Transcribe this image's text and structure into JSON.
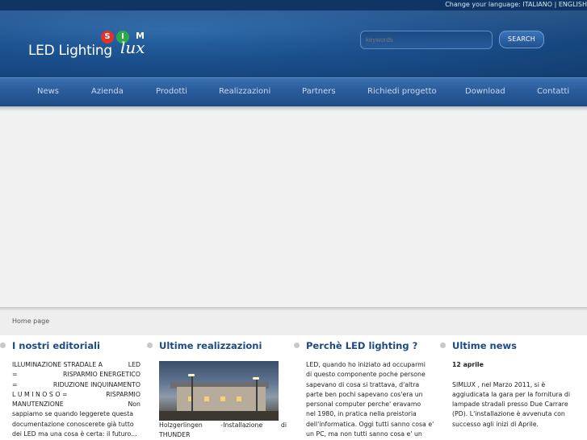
{
  "header": {
    "language_bar": "Change your language: ITALIANO | ENGLISH",
    "logo": {
      "text_main": "LED Lighting",
      "sim_letters": [
        "S",
        "I",
        "M"
      ],
      "lux": "lux",
      "colors": {
        "s": "#e2332b",
        "i": "#2fa84a"
      }
    },
    "search": {
      "placeholder": "keywords",
      "button_label": "SEARCH"
    }
  },
  "nav": {
    "items": [
      "News",
      "Azienda",
      "Prodotti",
      "Realizzazioni",
      "Partners",
      "Richiedi progetto",
      "Download",
      "Contatti"
    ]
  },
  "breadcrumb": "Home page",
  "columns": {
    "editoriali": {
      "title": "I nostri editoriali",
      "lines": [
        "ILLUMINAZIONE STRADALE A LED",
        "= RISPARMIO ENERGETICO",
        "= RIDUZIONE INQUINAMENTO",
        "L U M I N O S O = RISPARMIO",
        "MANUTENZIONE Non",
        "sappiamo se quando leggerete questa",
        "documentazione conoscerete già tutto",
        "dei LED ma una cosa è certa: il futuro..."
      ]
    },
    "realizzazioni": {
      "title": "Ultime realizzazioni",
      "caption_line1_left": "Holzgerlingen",
      "caption_line1_mid": "-Installazione",
      "caption_line1_right": "di",
      "caption_line2": "THUNDER"
    },
    "perche": {
      "title": "Perchè LED lighting ?",
      "lines": [
        "LED, quando ho iniziato ad occuparmi",
        "di questo componente poche persone",
        "sapevano di cosa si trattava, d'altra",
        "parte ben pochi sapevano cos'era un",
        "personal computer perche' eravamo",
        "nel 1980, in pratica nella preistoria",
        "dell'informatica. Oggi tutti sanno cosa e'",
        "un PC, ma non tutti sanno cosa e' un"
      ]
    },
    "news": {
      "title": "Ultime news",
      "date": "12 aprile",
      "lines": [
        "SIMLUX , nel Marzo 2011, si è",
        "aggiudicata la gara per la fornitura di",
        "lampade stradali presso Due Carrare",
        "(PD). L'installazione è avvenuta con",
        "successo agli inizi di Aprile."
      ]
    }
  }
}
